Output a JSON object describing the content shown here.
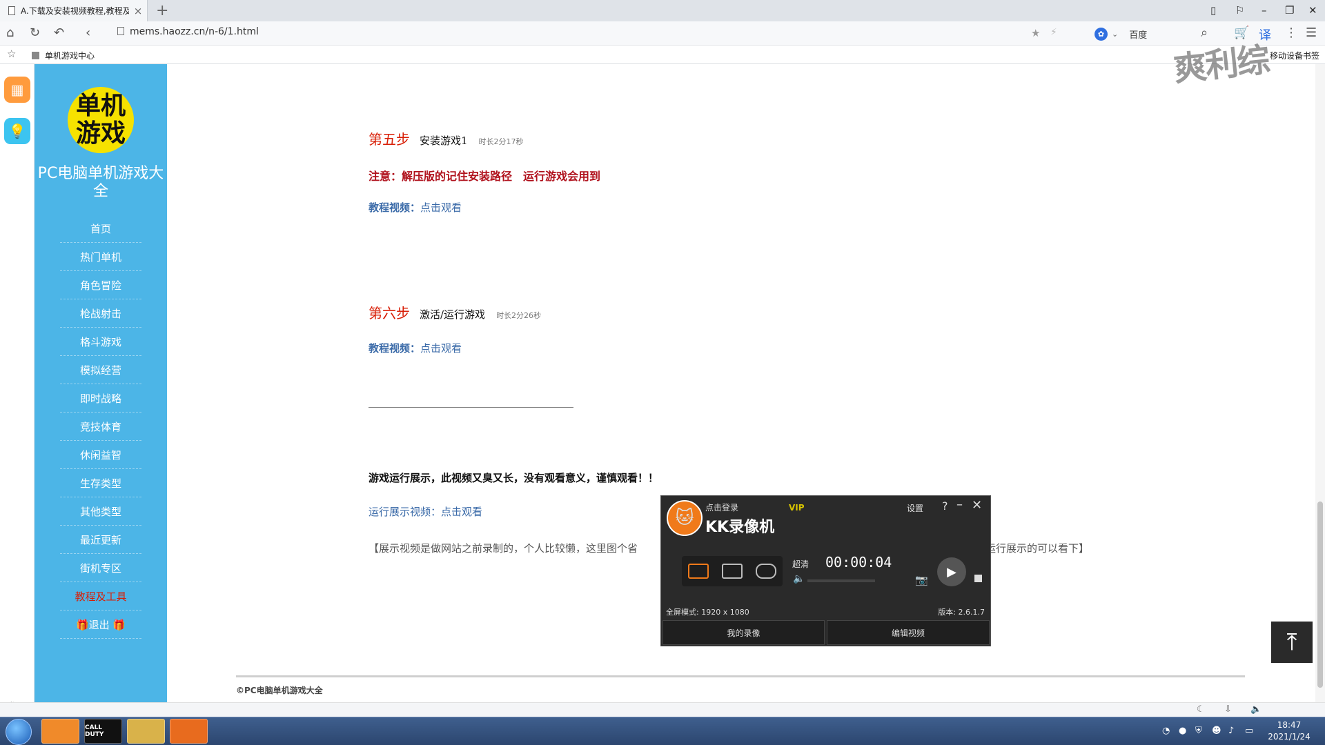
{
  "browser": {
    "tab_title": "A.下载及安装视频教程,教程及",
    "tab_close": "×",
    "new_tab": "+",
    "url": "mems.haozz.cn/n-6/1.html",
    "search_engine_label": "百度",
    "bookmark_item": "单机游戏中心",
    "bookmark_mobile": "移动设备书签"
  },
  "watermark": "爽利综",
  "sidebar": {
    "logo_text": "单机游戏",
    "site_title": "PC电脑单机游戏大全",
    "nav_items": [
      {
        "label": "首页"
      },
      {
        "label": "热门单机"
      },
      {
        "label": "角色冒险"
      },
      {
        "label": "枪战射击"
      },
      {
        "label": "格斗游戏"
      },
      {
        "label": "模拟经营"
      },
      {
        "label": "即时战略"
      },
      {
        "label": "竞技体育"
      },
      {
        "label": "休闲益智"
      },
      {
        "label": "生存类型"
      },
      {
        "label": "其他类型"
      },
      {
        "label": "最近更新"
      },
      {
        "label": "街机专区"
      },
      {
        "label": "教程及工具",
        "active": true
      },
      {
        "label": "🎁退出 🎁"
      }
    ]
  },
  "content": {
    "step5": {
      "num": "第五步",
      "name": "安装游戏1",
      "duration": "时长2分17秒"
    },
    "step5_note": "注意：解压版的记住安装路径　运行游戏会用到",
    "step5_video_label": "教程视频：",
    "step5_video_link": "点击观看",
    "step6": {
      "num": "第六步",
      "name": "激活/运行游戏",
      "duration": "时长2分26秒"
    },
    "step6_video_label": "教程视频：",
    "step6_video_link": "点击观看",
    "warning": "游戏运行展示，此视频又臭又长，没有观看意义，谨慎观看！！",
    "demo_video_label": "运行展示视频：",
    "demo_video_link": "点击观看",
    "paragraph_start": "【展示视频是做网站之前录制的，个人比较懒，这里图个省",
    "paragraph_end": "想看运行展示的可以看下】",
    "footer": "©PC电脑单机游戏大全"
  },
  "recorder": {
    "login": "点击登录",
    "vip": "VIP",
    "name": "KK录像机",
    "settings": "设置",
    "help": "?",
    "quality": "超清",
    "timer": "00:00:04",
    "mode_text": "全屏模式: 1920 x 1080",
    "version": "版本: 2.6.1.7",
    "my_recordings": "我的录像",
    "edit_video": "编辑视频"
  },
  "taskbar": {
    "app_label_cod": "CALL DUTY",
    "clock_time": "18:47",
    "clock_date": "2021/1/24"
  },
  "colors": {
    "sidebar_bg": "#4cb5e7",
    "step_red": "#d81e06",
    "note_red": "#b0111c",
    "link_blue": "#3a6aa8",
    "logo_yellow": "#f6e200"
  }
}
